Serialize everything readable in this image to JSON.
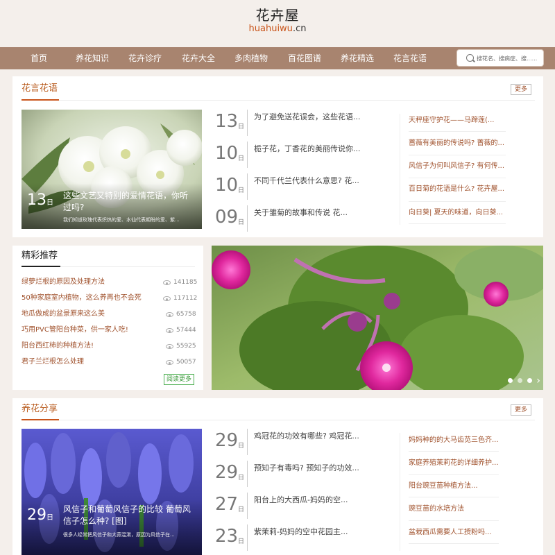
{
  "logo": {
    "cn": "花卉屋",
    "en_main": "huahuiwu",
    "en_dom": ".cn"
  },
  "nav": [
    {
      "label": "首页"
    },
    {
      "label": "养花知识"
    },
    {
      "label": "花卉诊疗"
    },
    {
      "label": "花卉大全"
    },
    {
      "label": "多肉植物"
    },
    {
      "label": "百花图谱"
    },
    {
      "label": "养花精选"
    },
    {
      "label": "花言花语"
    }
  ],
  "search": {
    "placeholder": "搜花名、搜病症、搜......"
  },
  "section1": {
    "title": "花言花语",
    "more": "更多",
    "feature": {
      "day": "13",
      "unit": "日",
      "title": "这些文艺又特别的爱情花语，你听过吗?",
      "desc": "我们知道玫瑰代表炽热的爱、水仙代表期盼的爱、紫..."
    },
    "dates": [
      {
        "day": "13",
        "unit": "日",
        "title": "为了避免送花误会，这些花语..."
      },
      {
        "day": "10",
        "unit": "日",
        "title": "栀子花，丁香花的美丽传说你..."
      },
      {
        "day": "10",
        "unit": "日",
        "title": "不同千代兰代表什么意思? 花..."
      },
      {
        "day": "09",
        "unit": "日",
        "title": "关于雏菊的故事和传说 花..."
      }
    ],
    "side": [
      "天秤座守护花——马蹄莲(...",
      "蔷薇有美丽的传说吗? 蔷薇的...",
      "风信子为何叫风信子? 有何传...",
      "百日菊的花语是什么? 花卉屋...",
      "向日葵| 夏天的味道，向日葵..."
    ]
  },
  "recommend": {
    "title": "精彩推荐",
    "items": [
      {
        "label": "绿萝烂根的原因及处理方法",
        "count": "141185"
      },
      {
        "label": "50种家庭室内植物，这么养再也不会死",
        "count": "117112"
      },
      {
        "label": "地瓜做成的盆景原来这么美",
        "count": "65758"
      },
      {
        "label": "巧用PVC管阳台种菜，供一家人吃!",
        "count": "57444"
      },
      {
        "label": "阳台西红柿的种植方法!",
        "count": "55925"
      },
      {
        "label": "君子兰烂根怎么处理",
        "count": "50057"
      }
    ],
    "readmore": "阅读更多"
  },
  "slider": {
    "next": "›"
  },
  "section2": {
    "title": "养花分享",
    "more": "更多",
    "feature": {
      "day": "29",
      "unit": "日",
      "title": "风信子和葡萄风信子的比较 葡萄风信子怎么种? [图]",
      "desc": "很多人经常把风信子和大蒜混淆，原因为风信子在..."
    },
    "dates": [
      {
        "day": "29",
        "unit": "日",
        "title": "鸡冠花的功效有哪些? 鸡冠花..."
      },
      {
        "day": "29",
        "unit": "日",
        "title": "预知子有毒吗? 预知子的功效..."
      },
      {
        "day": "27",
        "unit": "日",
        "title": "阳台上的大西瓜-妈妈的空..."
      },
      {
        "day": "23",
        "unit": "日",
        "title": "紫茉莉-妈妈的空中花园主..."
      }
    ],
    "side": [
      "妈妈种的的大马齿苋三色齐...",
      "家庭养殖茉莉花的详细养护...",
      "阳台豌豆苗种植方法...",
      "豌豆苗的水培方法",
      "盆栽西瓜需要人工授粉吗..."
    ]
  },
  "colors": {
    "nav": "#a8846f",
    "accent": "#c9541a",
    "link": "#a0522d",
    "bg": "#f4efeb"
  }
}
